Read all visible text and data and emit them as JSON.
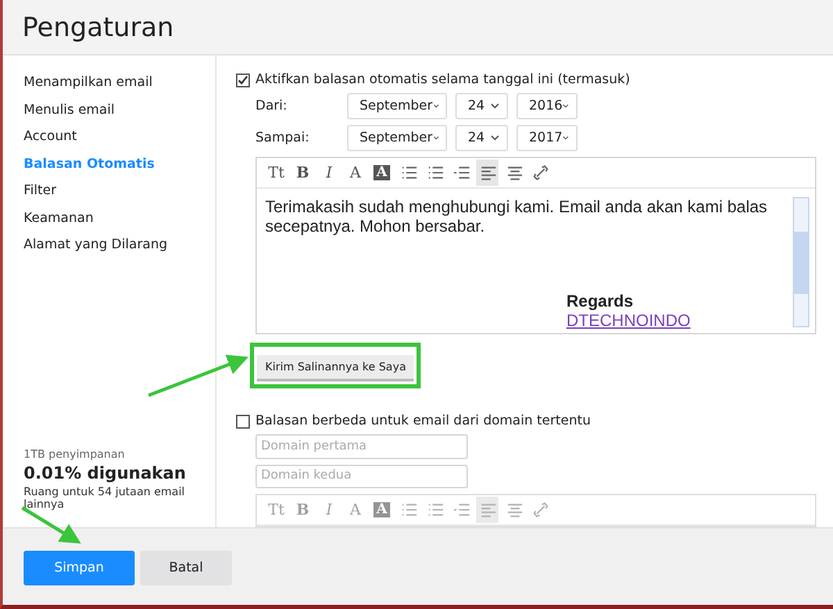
{
  "window": {
    "title": "Pengaturan"
  },
  "sidebar": {
    "items": [
      {
        "label": "Menampilkan email",
        "selected": false
      },
      {
        "label": "Menulis email",
        "selected": false
      },
      {
        "label": "Account",
        "selected": false
      },
      {
        "label": "Balasan Otomatis",
        "selected": true
      },
      {
        "label": "Filter",
        "selected": false
      },
      {
        "label": "Keamanan",
        "selected": false
      },
      {
        "label": "Alamat yang Dilarang",
        "selected": false
      }
    ],
    "storage": {
      "caption": "1TB penyimpanan",
      "usage": "0.01% digunakan",
      "note": "Ruang untuk 54 jutaan email lainnya"
    }
  },
  "auto_reply": {
    "label": "Aktifkan balasan otomatis selama tanggal ini (termasuk)",
    "checked": true,
    "dates": [
      {
        "label": "Dari:",
        "month": "September",
        "day": "24",
        "year": "2016"
      },
      {
        "label": "Sampai:",
        "month": "September",
        "day": "24",
        "year": "2017"
      }
    ],
    "editor": {
      "disabled": false,
      "toolbar": [
        {
          "kind": "text",
          "label": "Tt",
          "selected": false
        },
        {
          "kind": "bold",
          "label": "B",
          "selected": false
        },
        {
          "kind": "italic",
          "label": "I",
          "selected": false
        },
        {
          "kind": "text",
          "label": "A",
          "selected": false
        },
        {
          "kind": "inverted",
          "label": "A",
          "selected": false
        },
        {
          "kind": "bullets",
          "selected": false
        },
        {
          "kind": "numbers",
          "selected": false
        },
        {
          "kind": "indent",
          "selected": false
        },
        {
          "kind": "align-left",
          "selected": true
        },
        {
          "kind": "align-center",
          "selected": false
        },
        {
          "kind": "link",
          "selected": false
        }
      ],
      "body": "Terimakasih sudah menghubungi kami. Email anda akan kami balas secepatnya. Mohon bersabar.",
      "signature": "Regards",
      "signature_link": "DTECHNOINDO"
    },
    "copy_button": "Kirim Salinannya ke Saya"
  },
  "domain_reply": {
    "label": "Balasan berbeda untuk email dari domain tertentu",
    "checked": false,
    "fields": [
      {
        "placeholder": "Domain pertama"
      },
      {
        "placeholder": "Domain kedua"
      }
    ],
    "editor": {
      "disabled": true,
      "toolbar": [
        {
          "kind": "text",
          "label": "Tt",
          "selected": false
        },
        {
          "kind": "bold",
          "label": "B",
          "selected": false
        },
        {
          "kind": "italic",
          "label": "I",
          "selected": false
        },
        {
          "kind": "text",
          "label": "A",
          "selected": false
        },
        {
          "kind": "inverted",
          "label": "A",
          "selected": false
        },
        {
          "kind": "bullets",
          "selected": false
        },
        {
          "kind": "numbers",
          "selected": false
        },
        {
          "kind": "indent",
          "selected": false
        },
        {
          "kind": "align-left",
          "selected": true
        },
        {
          "kind": "align-center",
          "selected": false
        },
        {
          "kind": "link",
          "selected": false
        }
      ]
    }
  },
  "footer": {
    "buttons": [
      {
        "label": "Simpan",
        "kind": "primary"
      },
      {
        "label": "Batal",
        "kind": "secondary"
      }
    ]
  }
}
